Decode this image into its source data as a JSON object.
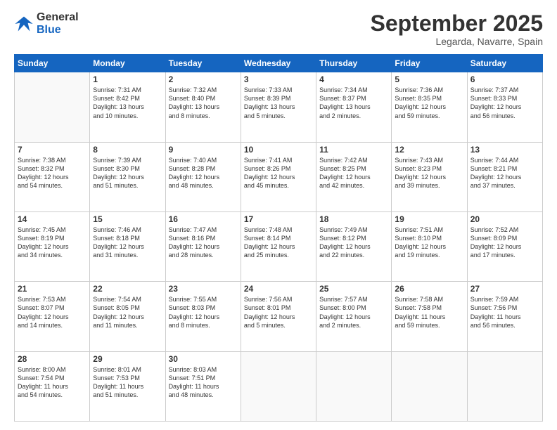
{
  "logo": {
    "line1": "General",
    "line2": "Blue"
  },
  "title": "September 2025",
  "location": "Legarda, Navarre, Spain",
  "days": [
    "Sunday",
    "Monday",
    "Tuesday",
    "Wednesday",
    "Thursday",
    "Friday",
    "Saturday"
  ],
  "weeks": [
    [
      {
        "day": "",
        "content": ""
      },
      {
        "day": "1",
        "content": "Sunrise: 7:31 AM\nSunset: 8:42 PM\nDaylight: 13 hours\nand 10 minutes."
      },
      {
        "day": "2",
        "content": "Sunrise: 7:32 AM\nSunset: 8:40 PM\nDaylight: 13 hours\nand 8 minutes."
      },
      {
        "day": "3",
        "content": "Sunrise: 7:33 AM\nSunset: 8:39 PM\nDaylight: 13 hours\nand 5 minutes."
      },
      {
        "day": "4",
        "content": "Sunrise: 7:34 AM\nSunset: 8:37 PM\nDaylight: 13 hours\nand 2 minutes."
      },
      {
        "day": "5",
        "content": "Sunrise: 7:36 AM\nSunset: 8:35 PM\nDaylight: 12 hours\nand 59 minutes."
      },
      {
        "day": "6",
        "content": "Sunrise: 7:37 AM\nSunset: 8:33 PM\nDaylight: 12 hours\nand 56 minutes."
      }
    ],
    [
      {
        "day": "7",
        "content": "Sunrise: 7:38 AM\nSunset: 8:32 PM\nDaylight: 12 hours\nand 54 minutes."
      },
      {
        "day": "8",
        "content": "Sunrise: 7:39 AM\nSunset: 8:30 PM\nDaylight: 12 hours\nand 51 minutes."
      },
      {
        "day": "9",
        "content": "Sunrise: 7:40 AM\nSunset: 8:28 PM\nDaylight: 12 hours\nand 48 minutes."
      },
      {
        "day": "10",
        "content": "Sunrise: 7:41 AM\nSunset: 8:26 PM\nDaylight: 12 hours\nand 45 minutes."
      },
      {
        "day": "11",
        "content": "Sunrise: 7:42 AM\nSunset: 8:25 PM\nDaylight: 12 hours\nand 42 minutes."
      },
      {
        "day": "12",
        "content": "Sunrise: 7:43 AM\nSunset: 8:23 PM\nDaylight: 12 hours\nand 39 minutes."
      },
      {
        "day": "13",
        "content": "Sunrise: 7:44 AM\nSunset: 8:21 PM\nDaylight: 12 hours\nand 37 minutes."
      }
    ],
    [
      {
        "day": "14",
        "content": "Sunrise: 7:45 AM\nSunset: 8:19 PM\nDaylight: 12 hours\nand 34 minutes."
      },
      {
        "day": "15",
        "content": "Sunrise: 7:46 AM\nSunset: 8:18 PM\nDaylight: 12 hours\nand 31 minutes."
      },
      {
        "day": "16",
        "content": "Sunrise: 7:47 AM\nSunset: 8:16 PM\nDaylight: 12 hours\nand 28 minutes."
      },
      {
        "day": "17",
        "content": "Sunrise: 7:48 AM\nSunset: 8:14 PM\nDaylight: 12 hours\nand 25 minutes."
      },
      {
        "day": "18",
        "content": "Sunrise: 7:49 AM\nSunset: 8:12 PM\nDaylight: 12 hours\nand 22 minutes."
      },
      {
        "day": "19",
        "content": "Sunrise: 7:51 AM\nSunset: 8:10 PM\nDaylight: 12 hours\nand 19 minutes."
      },
      {
        "day": "20",
        "content": "Sunrise: 7:52 AM\nSunset: 8:09 PM\nDaylight: 12 hours\nand 17 minutes."
      }
    ],
    [
      {
        "day": "21",
        "content": "Sunrise: 7:53 AM\nSunset: 8:07 PM\nDaylight: 12 hours\nand 14 minutes."
      },
      {
        "day": "22",
        "content": "Sunrise: 7:54 AM\nSunset: 8:05 PM\nDaylight: 12 hours\nand 11 minutes."
      },
      {
        "day": "23",
        "content": "Sunrise: 7:55 AM\nSunset: 8:03 PM\nDaylight: 12 hours\nand 8 minutes."
      },
      {
        "day": "24",
        "content": "Sunrise: 7:56 AM\nSunset: 8:01 PM\nDaylight: 12 hours\nand 5 minutes."
      },
      {
        "day": "25",
        "content": "Sunrise: 7:57 AM\nSunset: 8:00 PM\nDaylight: 12 hours\nand 2 minutes."
      },
      {
        "day": "26",
        "content": "Sunrise: 7:58 AM\nSunset: 7:58 PM\nDaylight: 11 hours\nand 59 minutes."
      },
      {
        "day": "27",
        "content": "Sunrise: 7:59 AM\nSunset: 7:56 PM\nDaylight: 11 hours\nand 56 minutes."
      }
    ],
    [
      {
        "day": "28",
        "content": "Sunrise: 8:00 AM\nSunset: 7:54 PM\nDaylight: 11 hours\nand 54 minutes."
      },
      {
        "day": "29",
        "content": "Sunrise: 8:01 AM\nSunset: 7:53 PM\nDaylight: 11 hours\nand 51 minutes."
      },
      {
        "day": "30",
        "content": "Sunrise: 8:03 AM\nSunset: 7:51 PM\nDaylight: 11 hours\nand 48 minutes."
      },
      {
        "day": "",
        "content": ""
      },
      {
        "day": "",
        "content": ""
      },
      {
        "day": "",
        "content": ""
      },
      {
        "day": "",
        "content": ""
      }
    ]
  ]
}
